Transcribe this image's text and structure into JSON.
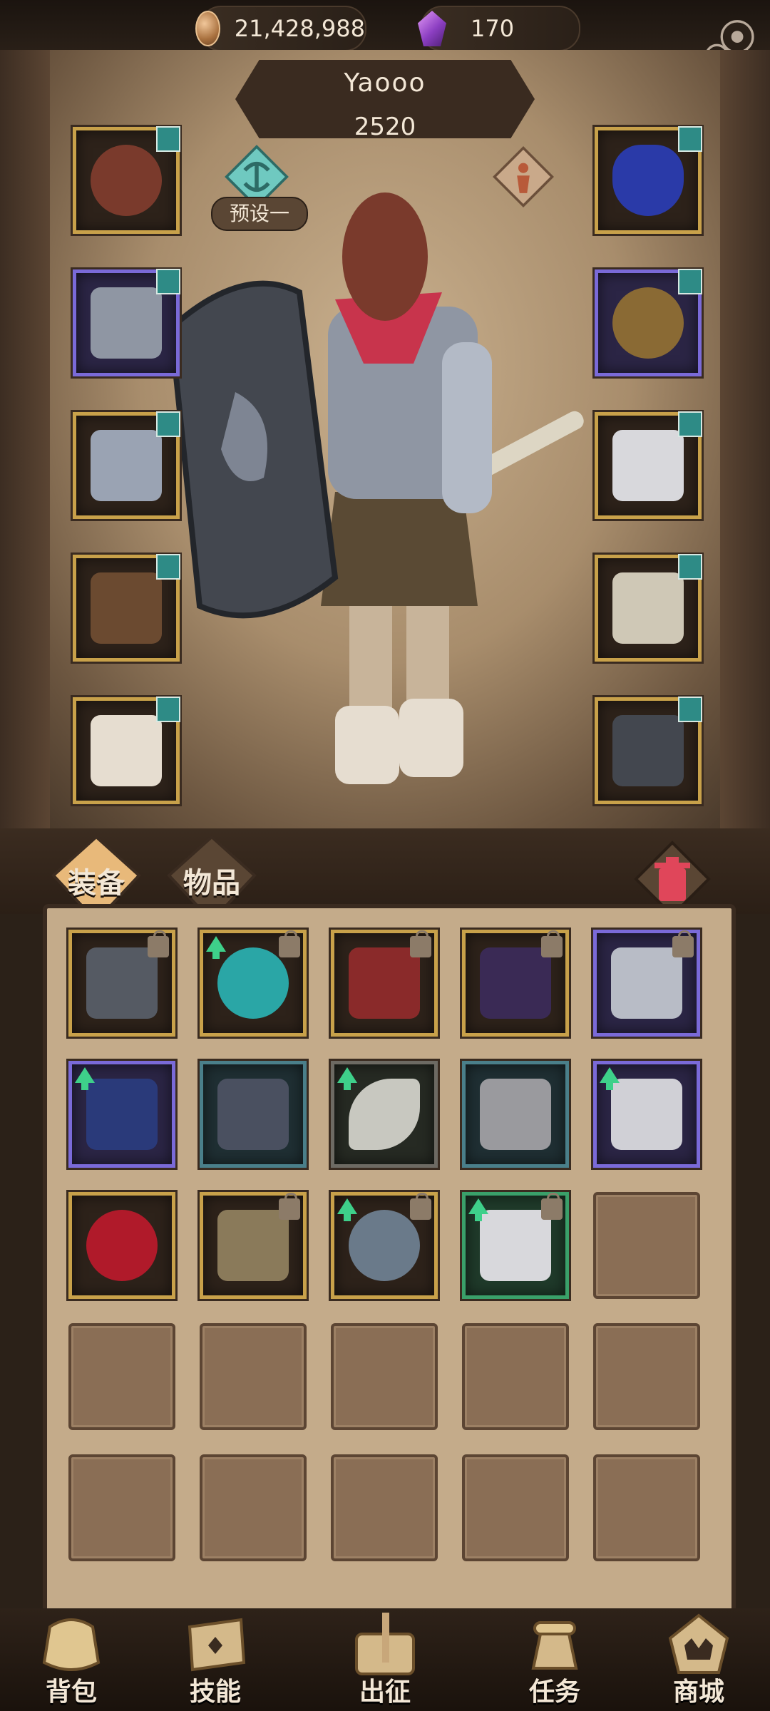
{
  "currency": {
    "coins": "21,428,988",
    "gems": "170"
  },
  "player": {
    "name": "Yaooo",
    "power": "2520"
  },
  "preset": {
    "label": "预设一"
  },
  "tabs": [
    {
      "label": "装备"
    },
    {
      "label": "物品"
    }
  ],
  "nav": [
    {
      "label": "背包",
      "icon": "backpack-icon"
    },
    {
      "label": "技能",
      "icon": "skill-book-icon"
    },
    {
      "label": "出征",
      "icon": "battle-map-icon"
    },
    {
      "label": "任务",
      "icon": "quest-scroll-icon"
    },
    {
      "label": "商城",
      "icon": "shop-crown-icon"
    }
  ],
  "equipped": {
    "left": [
      "head",
      "chest",
      "gloves",
      "belt",
      "boots"
    ],
    "right": [
      "necklace",
      "ring",
      "shoulder",
      "weapon",
      "shield"
    ]
  },
  "inventory_items": [
    {
      "item": "feathered-hat",
      "rarity": "gold",
      "locked": true,
      "upgrade": false
    },
    {
      "item": "emerald-amulet",
      "rarity": "gold",
      "locked": true,
      "upgrade": true
    },
    {
      "item": "red-bracer",
      "rarity": "gold",
      "locked": true,
      "upgrade": false
    },
    {
      "item": "spiked-crown",
      "rarity": "gold",
      "locked": true,
      "upgrade": false
    },
    {
      "item": "winged-helm",
      "rarity": "purple",
      "locked": true,
      "upgrade": false
    },
    {
      "item": "blue-pants",
      "rarity": "purple",
      "locked": false,
      "upgrade": true
    },
    {
      "item": "plate-armor",
      "rarity": "teal",
      "locked": false,
      "upgrade": false
    },
    {
      "item": "curved-blade",
      "rarity": "gray",
      "locked": false,
      "upgrade": true
    },
    {
      "item": "leather-chestplate",
      "rarity": "teal",
      "locked": false,
      "upgrade": false
    },
    {
      "item": "dagger",
      "rarity": "purple",
      "locked": false,
      "upgrade": true
    },
    {
      "item": "crimson-helm",
      "rarity": "gold",
      "locked": false,
      "upgrade": false
    },
    {
      "item": "beast-mask",
      "rarity": "gold",
      "locked": true,
      "upgrade": false
    },
    {
      "item": "serpent-chain",
      "rarity": "gold",
      "locked": true,
      "upgrade": true
    },
    {
      "item": "steel-gauntlet",
      "rarity": "green",
      "locked": true,
      "upgrade": true
    }
  ],
  "colors": {
    "gold": "#c8a14a",
    "purple": "#7a6ad8",
    "teal": "#4a7f8a",
    "green": "#3aa06a",
    "gray": "#6d6a63",
    "level_badge": "#2e8b86"
  }
}
